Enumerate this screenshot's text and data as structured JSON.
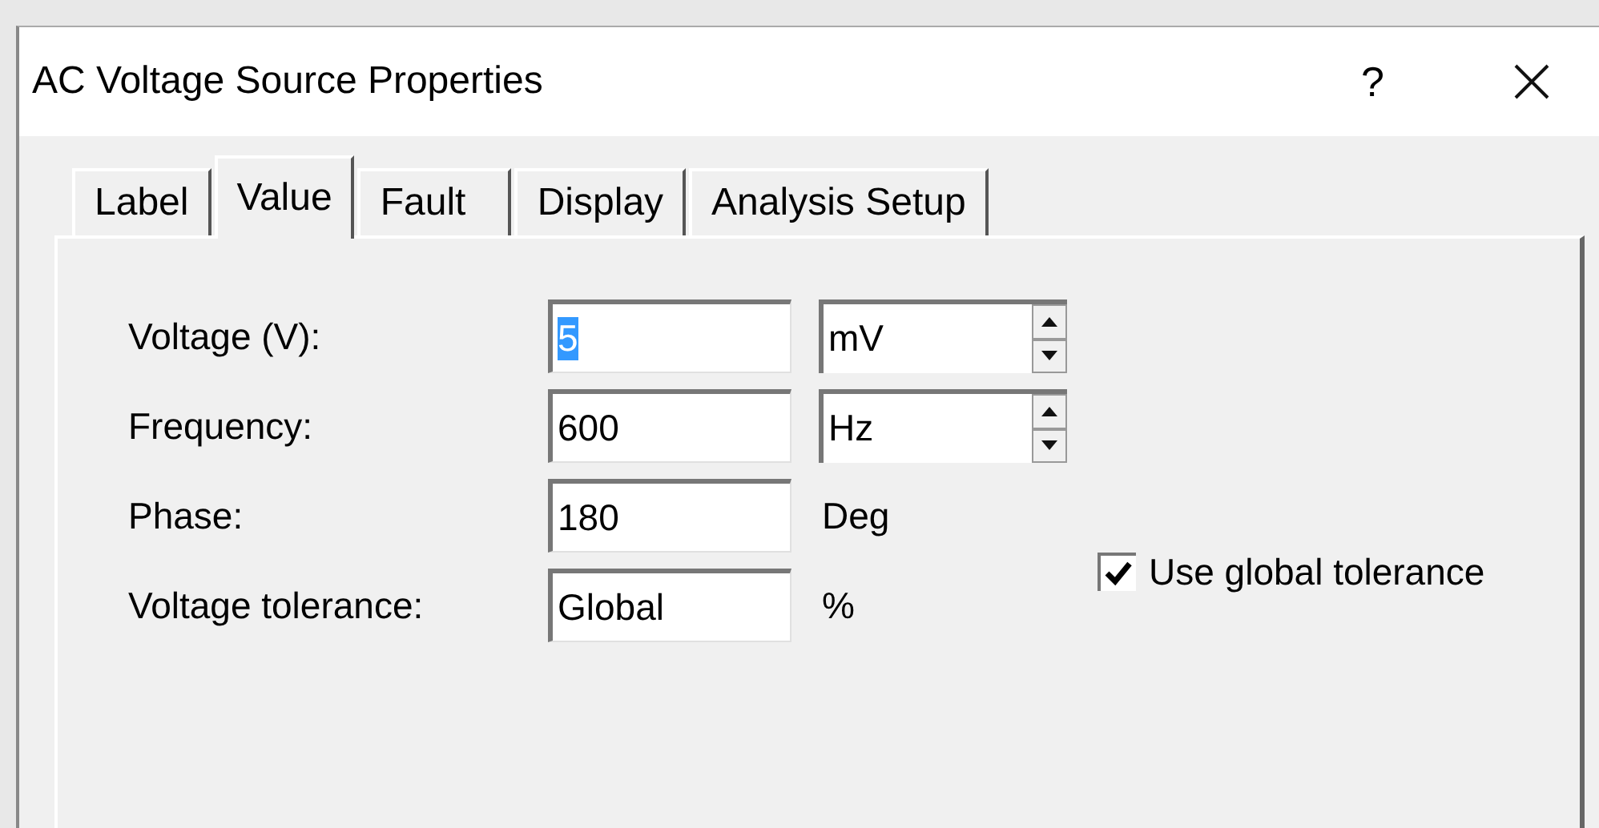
{
  "window": {
    "title": "AC Voltage Source Properties",
    "help_button": "?"
  },
  "tabs": [
    {
      "label": "Label",
      "selected": false
    },
    {
      "label": "Value",
      "selected": true
    },
    {
      "label": "Fault",
      "selected": false
    },
    {
      "label": "Display",
      "selected": false
    },
    {
      "label": "Analysis Setup",
      "selected": false
    }
  ],
  "rows": [
    {
      "label": "Voltage (V):",
      "value": "5",
      "value_selected": true,
      "unit": {
        "kind": "spinner",
        "text": "mV"
      }
    },
    {
      "label": "Frequency:",
      "value": "600",
      "value_selected": false,
      "unit": {
        "kind": "spinner",
        "text": "Hz"
      }
    },
    {
      "label": "Phase:",
      "value": "180",
      "value_selected": false,
      "unit": {
        "kind": "text",
        "text": "Deg"
      }
    },
    {
      "label": "Voltage tolerance:",
      "value": "Global",
      "value_selected": false,
      "unit": {
        "kind": "text",
        "text": "%"
      }
    }
  ],
  "checkbox": {
    "label": "Use global tolerance",
    "checked": true
  }
}
